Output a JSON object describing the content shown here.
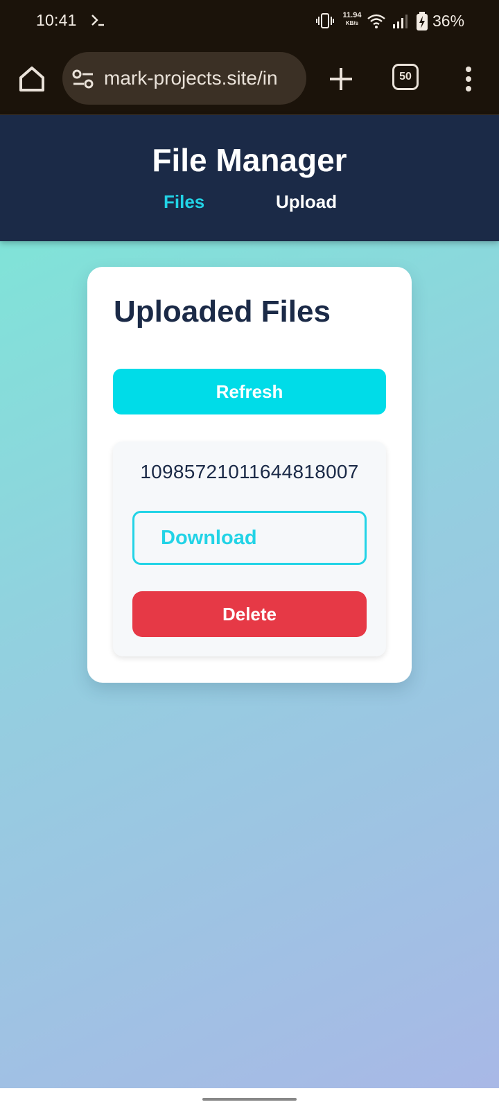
{
  "status_bar": {
    "time": "10:41",
    "net_speed_value": "11.94",
    "net_speed_unit": "KB/s",
    "battery": "36%",
    "icons": [
      "terminal-icon",
      "vibrate-icon",
      "wifi-icon",
      "signal-icon",
      "battery-charging-icon"
    ]
  },
  "browser": {
    "url": "mark-projects.site/in",
    "tab_count": "50",
    "icons": [
      "home-icon",
      "site-settings-icon",
      "plus-icon",
      "more-vert-icon"
    ]
  },
  "header": {
    "title": "File Manager",
    "nav": [
      {
        "label": "Files",
        "active": true
      },
      {
        "label": "Upload",
        "active": false
      }
    ],
    "bg_color": "#1b2a47",
    "accent_color": "#22d3e6"
  },
  "main": {
    "card_title": "Uploaded Files",
    "refresh_label": "Refresh",
    "files": [
      {
        "name": "10985721011644818007",
        "download_label": "Download",
        "delete_label": "Delete"
      }
    ],
    "delete_color": "#e63946",
    "refresh_color": "#00dce8"
  }
}
